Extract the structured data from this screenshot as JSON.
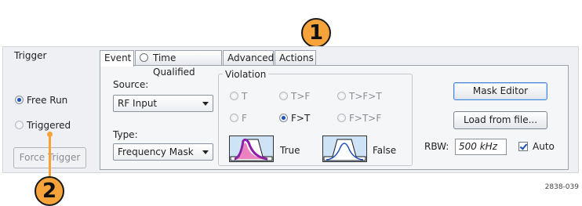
{
  "trigger": {
    "title": "Trigger",
    "modes": [
      {
        "label": "Free Run",
        "selected": true
      },
      {
        "label": "Triggered",
        "selected": false
      }
    ],
    "force_trigger_label": "Force Trigger"
  },
  "tabs": [
    {
      "label": "Event",
      "active": true
    },
    {
      "label": "Time Qualified",
      "active": false
    },
    {
      "label": "Advanced",
      "active": false
    },
    {
      "label": "Actions",
      "active": false
    }
  ],
  "event": {
    "source_label": "Source:",
    "source_value": "RF Input",
    "type_label": "Type:",
    "type_value": "Frequency Mask",
    "violation": {
      "title": "Violation",
      "options": [
        {
          "label": "T",
          "selected": false
        },
        {
          "label": "T>F",
          "selected": false
        },
        {
          "label": "T>F>T",
          "selected": false
        },
        {
          "label": "F",
          "selected": false
        },
        {
          "label": "F>T",
          "selected": true
        },
        {
          "label": "F>T>F",
          "selected": false
        }
      ],
      "true_label": "True",
      "false_label": "False"
    },
    "mask_editor_label": "Mask Editor",
    "load_from_file_label": "Load from file...",
    "rbw_label": "RBW:",
    "rbw_value": "500 kHz",
    "auto_label": "Auto",
    "auto_checked": true
  },
  "callouts": [
    "1",
    "2"
  ],
  "figure_number": "2838-039",
  "colors": {
    "callout": "#f5a33a",
    "selected_radio": "#1d4fb8",
    "mask_fill": "#cfe3f7",
    "trace_violation": "#8b1fa8"
  }
}
